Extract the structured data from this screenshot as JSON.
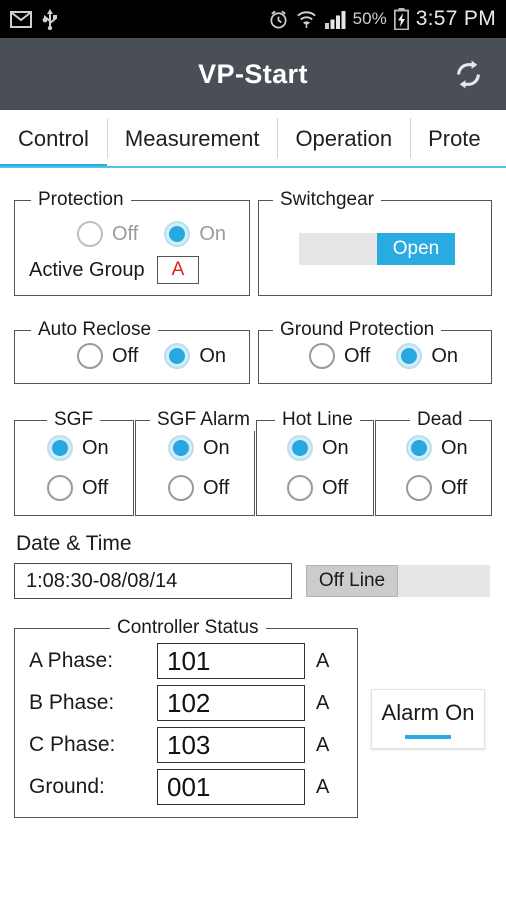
{
  "statusbar": {
    "icons_left": [
      "email-icon",
      "usb-icon"
    ],
    "icons_right": [
      "alarm-clock-icon",
      "wifi-icon",
      "signal-bars-icon",
      "battery-charging-icon"
    ],
    "battery_percent": "50%",
    "clock": "3:57 PM"
  },
  "appbar": {
    "title": "VP-Start",
    "action_icon": "refresh-icon"
  },
  "tabs": [
    {
      "label": "Control",
      "active": true
    },
    {
      "label": "Measurement",
      "active": false
    },
    {
      "label": "Operation",
      "active": false
    },
    {
      "label": "Prote",
      "active": false
    }
  ],
  "protection": {
    "legend": "Protection",
    "options": [
      {
        "label": "Off",
        "selected": false
      },
      {
        "label": "On",
        "selected": true
      }
    ],
    "active_group_label": "Active Group",
    "active_group_value": "A",
    "active_group_color": "#e02020"
  },
  "switchgear": {
    "legend": "Switchgear",
    "state_label": "Open",
    "thumb_side": "right",
    "accent": "#29ABE2"
  },
  "auto_reclose": {
    "legend": "Auto Reclose",
    "options": [
      {
        "label": "Off",
        "selected": false
      },
      {
        "label": "On",
        "selected": true
      }
    ]
  },
  "ground_protection": {
    "legend": "Ground Protection",
    "options": [
      {
        "label": "Off",
        "selected": false
      },
      {
        "label": "On",
        "selected": true
      }
    ]
  },
  "small_groups": [
    {
      "legend": "SGF",
      "options": [
        {
          "label": "On",
          "selected": true
        },
        {
          "label": "Off",
          "selected": false
        }
      ]
    },
    {
      "legend": "SGF Alarm",
      "options": [
        {
          "label": "On",
          "selected": true
        },
        {
          "label": "Off",
          "selected": false
        }
      ]
    },
    {
      "legend": "Hot Line",
      "options": [
        {
          "label": "On",
          "selected": true
        },
        {
          "label": "Off",
          "selected": false
        }
      ]
    },
    {
      "legend": "Dead",
      "options": [
        {
          "label": "On",
          "selected": true
        },
        {
          "label": "Off",
          "selected": false
        }
      ]
    }
  ],
  "datetime": {
    "label": "Date & Time",
    "value": "1:08:30-08/08/14",
    "connection_toggle": {
      "state_label": "Off Line",
      "thumb_side": "left"
    }
  },
  "controller_status": {
    "legend": "Controller Status",
    "rows": [
      {
        "label": "A Phase:",
        "value": "101",
        "unit": "A"
      },
      {
        "label": "B Phase:",
        "value": "102",
        "unit": "A"
      },
      {
        "label": "C Phase:",
        "value": "103",
        "unit": "A"
      },
      {
        "label": "Ground:",
        "value": "001",
        "unit": "A"
      }
    ]
  },
  "alarm": {
    "label": "Alarm On",
    "accent": "#29ABE2"
  }
}
